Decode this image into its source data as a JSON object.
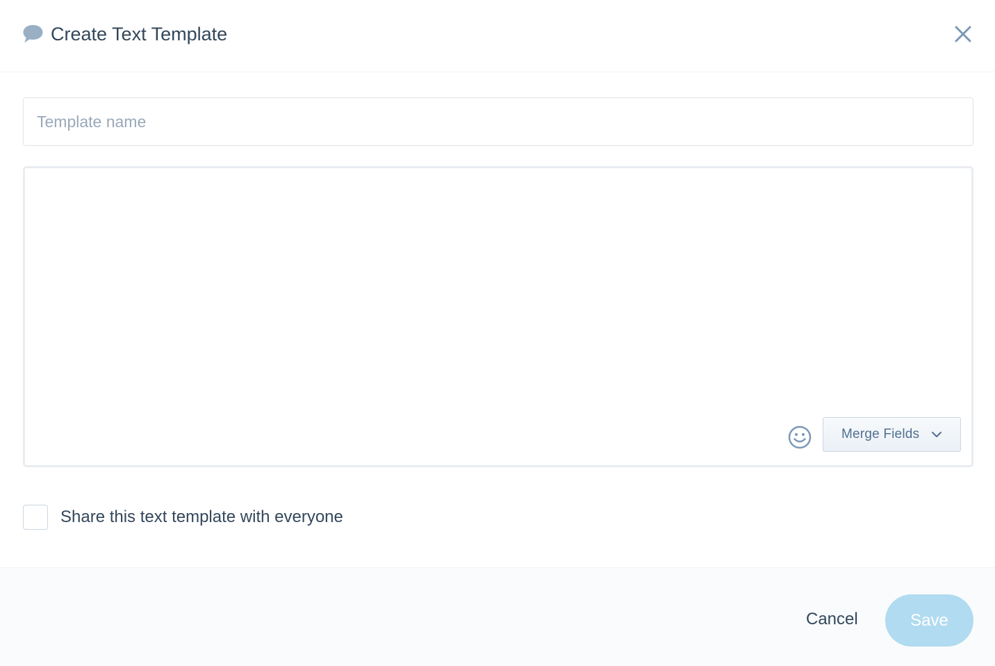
{
  "header": {
    "title": "Create Text Template",
    "icon": "speech-bubble-icon",
    "close_icon": "close-icon"
  },
  "form": {
    "name_placeholder": "Template name",
    "name_value": "",
    "body_value": "",
    "emoji_icon": "smiley-icon",
    "merge_fields_label": "Merge Fields",
    "share_label": "Share this text template with everyone",
    "share_checked": false
  },
  "footer": {
    "cancel_label": "Cancel",
    "save_label": "Save"
  },
  "colors": {
    "save_disabled": "#b0dbf1",
    "icon_gray": "#99afc4",
    "text_dark": "#33475b"
  }
}
